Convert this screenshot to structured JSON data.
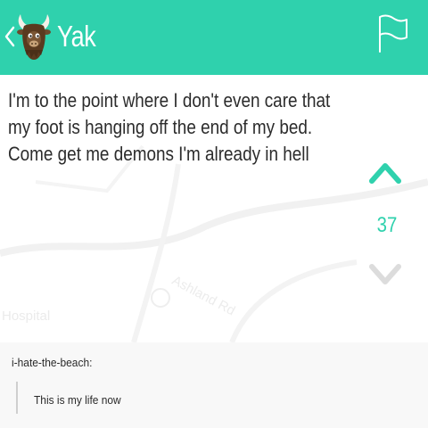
{
  "header": {
    "title": "Yak",
    "back_icon": "chevron-left-icon",
    "logo_icon": "yak-logo-icon",
    "flag_icon": "flag-icon",
    "background_color": "#2fd1ad"
  },
  "post": {
    "lines": [
      "I'm to the point where I don't even care that",
      "my foot is hanging off the end of my bed.",
      "Come get me demons I'm already in hell"
    ],
    "vote_count": "37",
    "upvote_icon": "chevron-up-icon",
    "downvote_icon": "chevron-down-icon",
    "accent_color": "#2fd1ad"
  },
  "map": {
    "labels": [
      "Hospital",
      "Ashland Rd"
    ]
  },
  "comment": {
    "author": "i-hate-the-beach:",
    "text": "This is my life now"
  }
}
